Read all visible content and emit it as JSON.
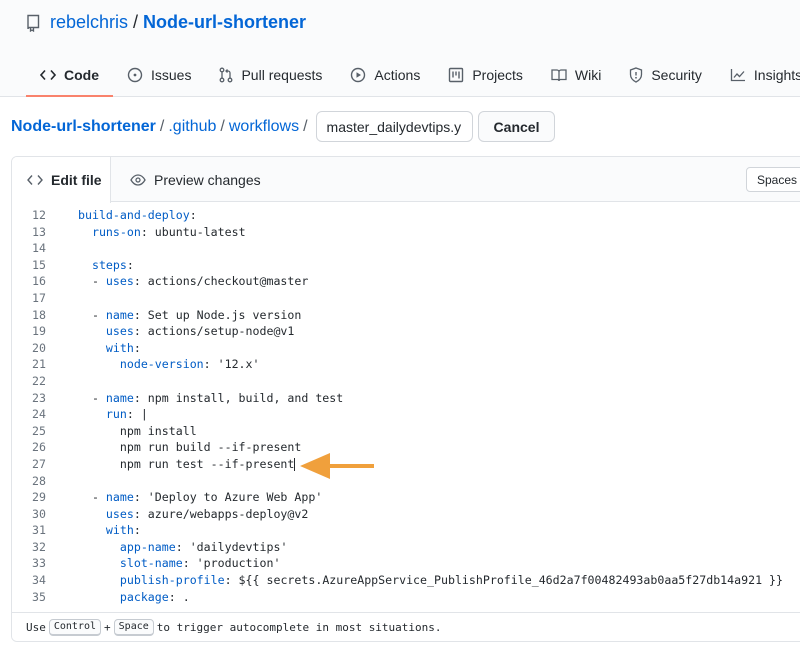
{
  "repo": {
    "owner": "rebelchris",
    "separator": "/",
    "name": "Node-url-shortener"
  },
  "nav": {
    "tabs": [
      {
        "label": "Code",
        "icon": "code-icon",
        "active": true
      },
      {
        "label": "Issues",
        "icon": "issue-icon"
      },
      {
        "label": "Pull requests",
        "icon": "pull-request-icon"
      },
      {
        "label": "Actions",
        "icon": "play-icon"
      },
      {
        "label": "Projects",
        "icon": "project-icon"
      },
      {
        "label": "Wiki",
        "icon": "book-icon"
      },
      {
        "label": "Security",
        "icon": "shield-icon"
      },
      {
        "label": "Insights",
        "icon": "graph-icon"
      }
    ]
  },
  "breadcrumb": {
    "root": "Node-url-shortener",
    "sep": "/",
    "dir1": ".github",
    "dir2": "workflows",
    "filename": "master_dailydevtips.yml",
    "cancel_label": "Cancel"
  },
  "editor": {
    "edit_tab": "Edit file",
    "preview_tab": "Preview changes",
    "indent_mode": "Spaces",
    "lines": [
      {
        "n": "12",
        "indent": "",
        "key": "build-and-deploy",
        "colon": ":",
        "val": ""
      },
      {
        "n": "13",
        "indent": "  ",
        "key": "runs-on",
        "colon": ":",
        "val": " ubuntu-latest"
      },
      {
        "n": "14",
        "indent": "",
        "key": "",
        "colon": "",
        "val": ""
      },
      {
        "n": "15",
        "indent": "  ",
        "key": "steps",
        "colon": ":",
        "val": ""
      },
      {
        "n": "16",
        "indent": "  - ",
        "key": "uses",
        "colon": ":",
        "val": " actions/checkout@master"
      },
      {
        "n": "17",
        "indent": "",
        "key": "",
        "colon": "",
        "val": ""
      },
      {
        "n": "18",
        "indent": "  - ",
        "key": "name",
        "colon": ":",
        "val": " Set up Node.js version"
      },
      {
        "n": "19",
        "indent": "    ",
        "key": "uses",
        "colon": ":",
        "val": " actions/setup-node@v1"
      },
      {
        "n": "20",
        "indent": "    ",
        "key": "with",
        "colon": ":",
        "val": ""
      },
      {
        "n": "21",
        "indent": "      ",
        "key": "node-version",
        "colon": ":",
        "val": " '12.x'"
      },
      {
        "n": "22",
        "indent": "",
        "key": "",
        "colon": "",
        "val": ""
      },
      {
        "n": "23",
        "indent": "  - ",
        "key": "name",
        "colon": ":",
        "val": " npm install, build, and test"
      },
      {
        "n": "24",
        "indent": "    ",
        "key": "run",
        "colon": ":",
        "val": " |"
      },
      {
        "n": "25",
        "indent": "      ",
        "key": "",
        "colon": "",
        "val": "npm install"
      },
      {
        "n": "26",
        "indent": "      ",
        "key": "",
        "colon": "",
        "val": "npm run build --if-present"
      },
      {
        "n": "27",
        "indent": "      ",
        "key": "",
        "colon": "",
        "val": "npm run test --if-present",
        "caret": true
      },
      {
        "n": "28",
        "indent": "",
        "key": "",
        "colon": "",
        "val": ""
      },
      {
        "n": "29",
        "indent": "  - ",
        "key": "name",
        "colon": ":",
        "val": " 'Deploy to Azure Web App'"
      },
      {
        "n": "30",
        "indent": "    ",
        "key": "uses",
        "colon": ":",
        "val": " azure/webapps-deploy@v2"
      },
      {
        "n": "31",
        "indent": "    ",
        "key": "with",
        "colon": ":",
        "val": ""
      },
      {
        "n": "32",
        "indent": "      ",
        "key": "app-name",
        "colon": ":",
        "val": " 'dailydevtips'"
      },
      {
        "n": "33",
        "indent": "      ",
        "key": "slot-name",
        "colon": ":",
        "val": " 'production'"
      },
      {
        "n": "34",
        "indent": "      ",
        "key": "publish-profile",
        "colon": ":",
        "val": " ${{ secrets.AzureAppService_PublishProfile_46d2a7f00482493ab0aa5f27db14a921 }}"
      },
      {
        "n": "35",
        "indent": "      ",
        "key": "package",
        "colon": ":",
        "val": " ."
      }
    ]
  },
  "footer": {
    "pre": "Use",
    "key1": "Control",
    "plus": "+",
    "key2": "Space",
    "post": "to trigger autocomplete in most situations."
  },
  "colors": {
    "link": "#0366d6",
    "active_tab_underline": "#f9826c",
    "arrow": "#f0a03c",
    "yaml_key": "#005cc5"
  }
}
